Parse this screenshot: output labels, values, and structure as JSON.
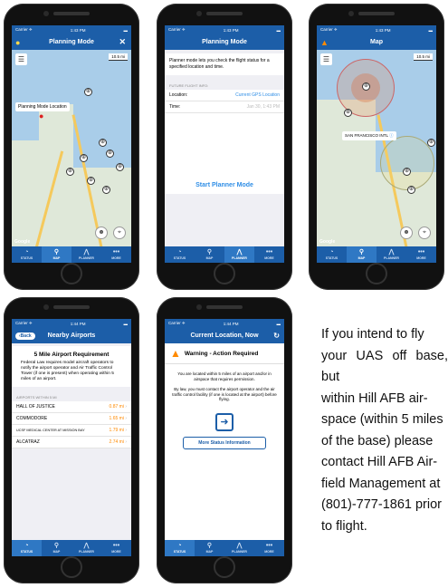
{
  "status": {
    "carrier": "Carrier ✈",
    "time1": "1:43 PM",
    "time2": "1:44 PM",
    "battery": "▬"
  },
  "tabs": [
    "STATUS",
    "MAP",
    "PLANNER",
    "MORE"
  ],
  "p1": {
    "title": "Planning Mode",
    "scale": "10.5 mi",
    "callout": "Planning Mode Location",
    "google": "Google"
  },
  "p2": {
    "title": "Planning Mode",
    "desc": "Planner mode lets you check the flight status for a specified location and time.",
    "section": "FUTURE FLIGHT INFO:",
    "location_label": "Location:",
    "location_value": "Current GPS Location",
    "time_label": "Time:",
    "time_value": "Jan 30, 1:43 PM",
    "button": "Start Planner Mode"
  },
  "p3": {
    "title": "Map",
    "scale": "10.5 mi",
    "callout": "SAN FRANCISCO INTL",
    "google": "Google"
  },
  "p4": {
    "back": "Back",
    "title": "Nearby Airports",
    "heading": "5 Mile Airport Requirement",
    "desc": "Federal Law requires model aircraft operators to notify the airport operator and Air Traffic Control Tower (if one is present) when operating within 5 miles of an airport.",
    "section": "AIRPORTS WITHIN 5 MI",
    "airports": [
      {
        "name": "HALL OF JUSTICE",
        "dist": "0.87 mi"
      },
      {
        "name": "COMMODORE",
        "dist": "1.65 mi"
      },
      {
        "name": "UCSF MEDICAL CENTER AT MISSION BAY",
        "dist": "1.79 mi"
      },
      {
        "name": "ALCATRAZ",
        "dist": "2.74 mi"
      }
    ]
  },
  "p5": {
    "title": "Current Location, Now",
    "warning": "Warning - Action Required",
    "msg1": "You are located within 5 miles of an airport and/or in airspace that requires permission.",
    "msg2": "By law, you must contact the airport operator and the air traffic control facility (if one is located at the airport) before flying.",
    "button": "More Status Information"
  },
  "side_lines": [
    "If you intend to fly",
    "your UAS off base, but",
    "within Hill AFB air-",
    "space (within 5 miles",
    "of the base) please",
    "contact Hill AFB Air-",
    "field Management at",
    "(801)-777-1861 prior",
    "to flight."
  ],
  "colors": {
    "primary": "#1c5ea8",
    "accent": "#ff8a00",
    "link": "#2f8ee6"
  }
}
